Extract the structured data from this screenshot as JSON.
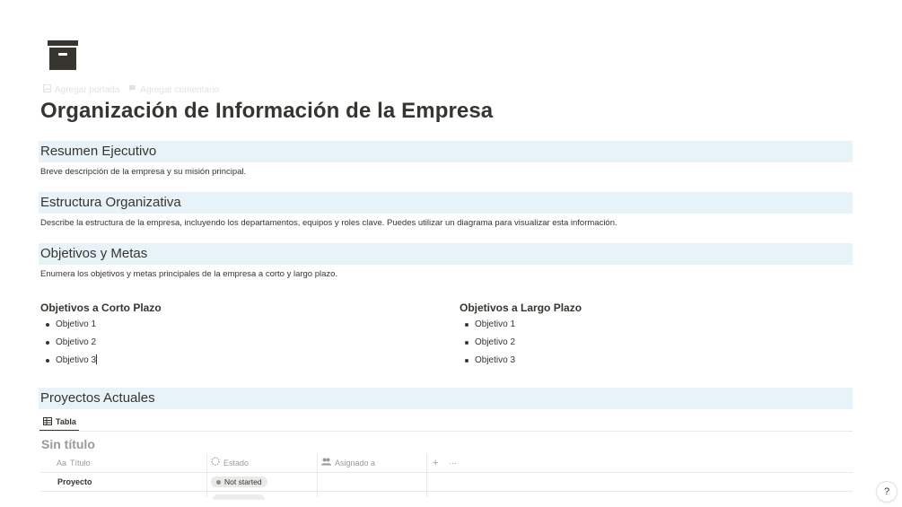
{
  "page": {
    "icon": "archive-box-icon",
    "title": "Organización de Información de la Empresa",
    "actions": {
      "add_cover": "Agregar portada",
      "add_comment": "Agregar comentario"
    }
  },
  "sections": {
    "summary": {
      "heading": "Resumen Ejecutivo",
      "text": "Breve descripción de la empresa y su misión principal."
    },
    "structure": {
      "heading": "Estructura Organizativa",
      "text": "Describe la estructura de la empresa, incluyendo los departamentos, equipos y roles clave. Puedes utilizar un diagrama para visualizar esta información."
    },
    "goals": {
      "heading": "Objetivos y Metas",
      "text": "Enumera los objetivos y metas principales de la empresa a corto y largo plazo."
    },
    "projects": {
      "heading": "Proyectos Actuales"
    }
  },
  "columns": {
    "short": {
      "title": "Objetivos a Corto Plazo",
      "items": [
        "Objetivo 1",
        "Objetivo 2",
        "Objetivo 3"
      ]
    },
    "long": {
      "title": "Objetivos a Largo Plazo",
      "items": [
        "Objetivo 1",
        "Objetivo 2",
        "Objetivo 3"
      ]
    }
  },
  "database": {
    "view_tab": "Tabla",
    "title": "Sin título",
    "headers": {
      "title_prefix": "Aa",
      "title": "Título",
      "status": "Estado",
      "assigned": "Asignado a",
      "add": "+",
      "more": "···"
    },
    "rows": [
      {
        "title": "Proyecto",
        "status": "Not started",
        "assigned": ""
      }
    ]
  },
  "help": "?",
  "colors": {
    "section_bg": "#e7f3f8",
    "text": "#37352f",
    "muted": "#9b9a97",
    "badge_bg": "#e9e9e7"
  }
}
